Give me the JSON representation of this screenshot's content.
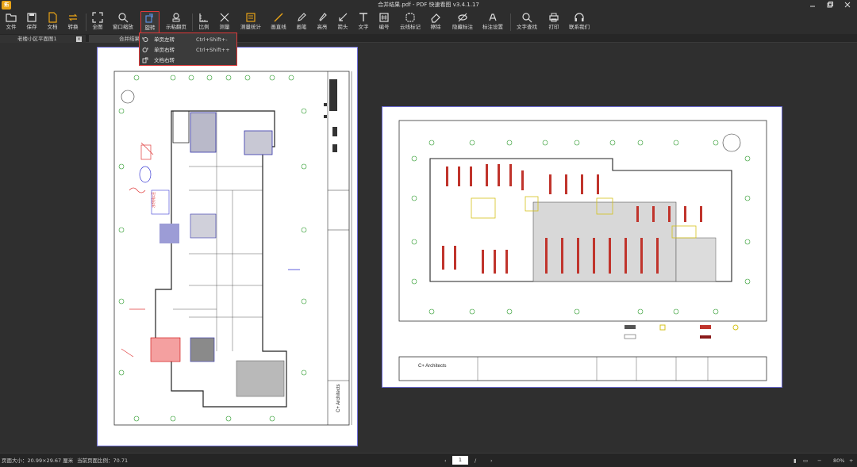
{
  "window": {
    "logo_text": "拓",
    "title": "合并结果.pdf - PDF 快速看图 v3.4.1.17",
    "controls": [
      "minimize",
      "maximize",
      "close"
    ]
  },
  "toolbar": {
    "items": [
      {
        "name": "file",
        "label": "文件",
        "icon": "folder-icon"
      },
      {
        "name": "save",
        "label": "保存",
        "icon": "save-icon"
      },
      {
        "name": "doc",
        "label": "文档",
        "icon": "document-icon"
      },
      {
        "name": "convert",
        "label": "转换",
        "icon": "convert-icon"
      },
      {
        "name": "fullview",
        "label": "全图",
        "icon": "fullscreen-icon"
      },
      {
        "name": "window-zoom",
        "label": "窗口缩放",
        "icon": "zoom-icon"
      },
      {
        "name": "rotate",
        "label": "旋转",
        "icon": "rotate-icon"
      },
      {
        "name": "page-extract",
        "label": "示粘翻页",
        "icon": "stamp-icon"
      },
      {
        "name": "ratio",
        "label": "比例",
        "icon": "ruler-icon"
      },
      {
        "name": "measure",
        "label": "测量",
        "icon": "measure-icon"
      },
      {
        "name": "stat",
        "label": "测量统计",
        "icon": "stat-icon"
      },
      {
        "name": "line",
        "label": "画直线",
        "icon": "line-icon"
      },
      {
        "name": "pen",
        "label": "画笔",
        "icon": "pen-icon"
      },
      {
        "name": "highlight",
        "label": "高亮",
        "icon": "highlight-icon"
      },
      {
        "name": "arrow",
        "label": "箭头",
        "icon": "arrow-icon"
      },
      {
        "name": "text",
        "label": "文字",
        "icon": "text-icon"
      },
      {
        "name": "number",
        "label": "编号",
        "icon": "number-icon"
      },
      {
        "name": "cloud",
        "label": "云线标记",
        "icon": "cloud-icon"
      },
      {
        "name": "erase",
        "label": "擦除",
        "icon": "eraser-icon"
      },
      {
        "name": "hide",
        "label": "隐藏标注",
        "icon": "hide-icon"
      },
      {
        "name": "mark-settings",
        "label": "标注设置",
        "icon": "settings-icon"
      },
      {
        "name": "text-search",
        "label": "文字查找",
        "icon": "search-icon"
      },
      {
        "name": "print",
        "label": "打印",
        "icon": "print-icon"
      },
      {
        "name": "contact",
        "label": "联系我们",
        "icon": "headset-icon"
      }
    ]
  },
  "tabs": [
    {
      "label": "老楼小区平面图1",
      "active": false
    },
    {
      "label": "合并结果",
      "active": true
    }
  ],
  "rotate_menu": {
    "items": [
      {
        "label": "单页左转",
        "shortcut": "Ctrl+Shift+-",
        "icon": "rotate-left-icon"
      },
      {
        "label": "单页右转",
        "shortcut": "Ctrl+Shift++",
        "icon": "rotate-right-icon"
      },
      {
        "label": "文档右转",
        "shortcut": "",
        "icon": "doc-rotate-icon"
      }
    ]
  },
  "drawing": {
    "firm_name": "C+ Architects"
  },
  "statusbar": {
    "page_size": "页面大小：20.99×29.67 厘米",
    "scale": "当前页面比例：70.71",
    "current_page": "1",
    "total_pages": "/ 2",
    "zoom": "80%"
  },
  "colors": {
    "accent_red": "#e03a3a",
    "page_border": "#6b6bd4",
    "background": "#2f2f2f"
  }
}
